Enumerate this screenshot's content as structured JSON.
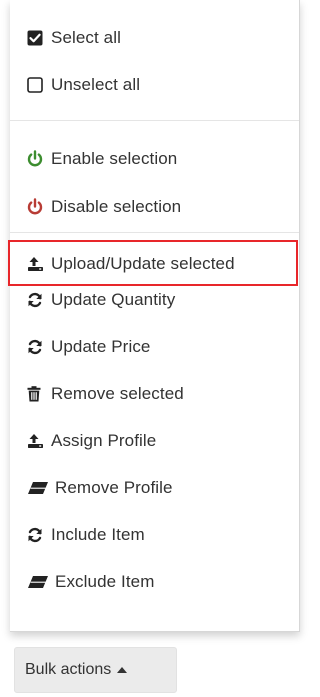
{
  "menu": {
    "select_all": "Select all",
    "unselect_all": "Unselect all",
    "enable_selection": "Enable selection",
    "disable_selection": "Disable selection",
    "upload_update_selected": "Upload/Update selected",
    "update_quantity": "Update Quantity",
    "update_price": "Update Price",
    "remove_selected": "Remove selected",
    "assign_profile": "Assign Profile",
    "remove_profile": "Remove Profile",
    "include_item": "Include Item",
    "exclude_item": "Exclude Item"
  },
  "bulk_button": {
    "label": "Bulk actions"
  },
  "colors": {
    "enable_icon": "#3c8d2f",
    "disable_icon": "#b83c35",
    "highlight_border": "#e8262a"
  },
  "icons": {
    "select_all": "checked-square-icon",
    "unselect_all": "empty-square-icon",
    "enable_selection": "power-icon",
    "disable_selection": "power-icon",
    "upload_update_selected": "upload-icon",
    "update_quantity": "refresh-icon",
    "update_price": "refresh-icon",
    "remove_selected": "trash-icon",
    "assign_profile": "upload-icon",
    "remove_profile": "eraser-icon",
    "include_item": "refresh-icon",
    "exclude_item": "eraser-icon"
  }
}
